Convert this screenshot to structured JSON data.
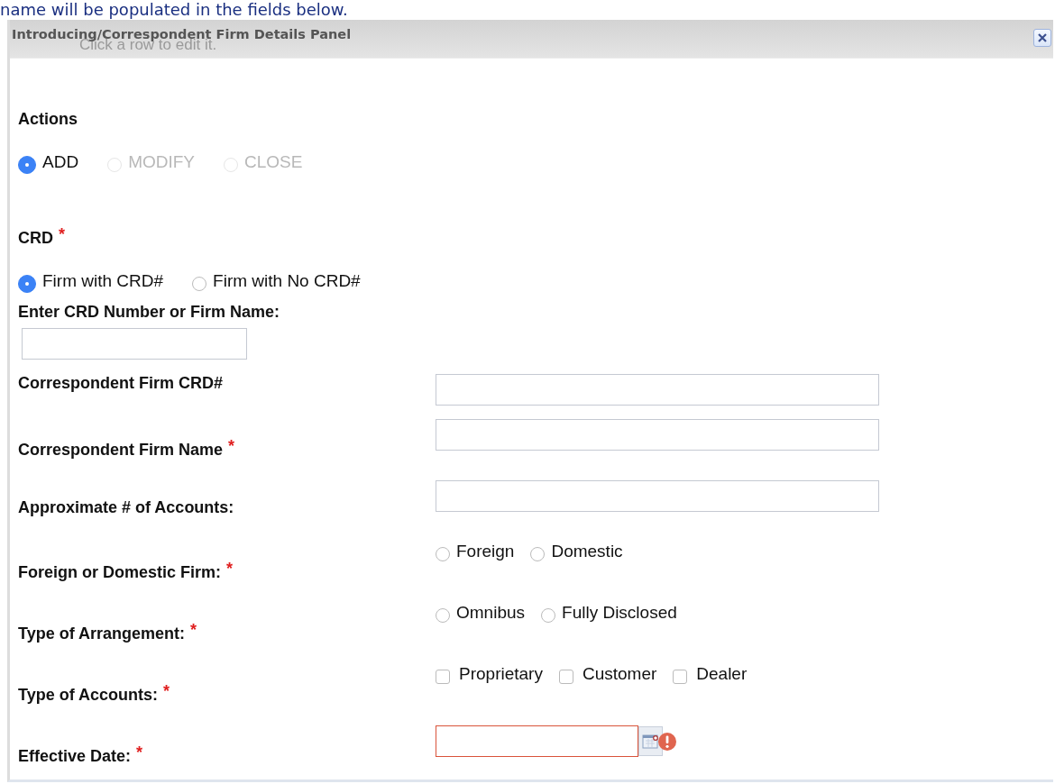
{
  "background": {
    "instruction": "name will be populated in the fields below.",
    "hint": "Click a row to edit it."
  },
  "dialog": {
    "title": "Introducing/Correspondent Firm Details Panel"
  },
  "actions": {
    "label": "Actions",
    "options": [
      {
        "label": "ADD",
        "selected": true,
        "disabled": false
      },
      {
        "label": "MODIFY",
        "selected": false,
        "disabled": true
      },
      {
        "label": "CLOSE",
        "selected": false,
        "disabled": true
      }
    ]
  },
  "crd": {
    "label": "CRD",
    "required_mark": "*",
    "options": [
      {
        "label": "Firm with CRD#",
        "selected": true,
        "disabled": false
      },
      {
        "label": "Firm with No CRD#",
        "selected": false,
        "disabled": false
      }
    ],
    "search_label": "Enter CRD Number or Firm Name:"
  },
  "fields": [
    {
      "kind": "text",
      "label": "Correspondent Firm CRD#"
    },
    {
      "kind": "text",
      "label": "Correspondent Firm Name",
      "required_mark": "*"
    },
    {
      "kind": "text",
      "label": "Approximate # of Accounts:"
    },
    {
      "kind": "radio",
      "label": "Foreign or Domestic Firm:",
      "required_mark": "*",
      "options": [
        {
          "label": "Foreign",
          "selected": false
        },
        {
          "label": "Domestic",
          "selected": false
        }
      ]
    },
    {
      "kind": "radio",
      "label": "Type of Arrangement:",
      "required_mark": "*",
      "options": [
        {
          "label": "Omnibus",
          "selected": false
        },
        {
          "label": "Fully Disclosed",
          "selected": false
        }
      ]
    },
    {
      "kind": "checkbox",
      "label": "Type of Accounts:",
      "required_mark": "*",
      "options": [
        {
          "label": "Proprietary",
          "checked": false
        },
        {
          "label": "Customer",
          "checked": false
        },
        {
          "label": "Dealer",
          "checked": false
        }
      ]
    },
    {
      "kind": "date",
      "label": "Effective Date:",
      "required_mark": "*",
      "error": true
    }
  ]
}
